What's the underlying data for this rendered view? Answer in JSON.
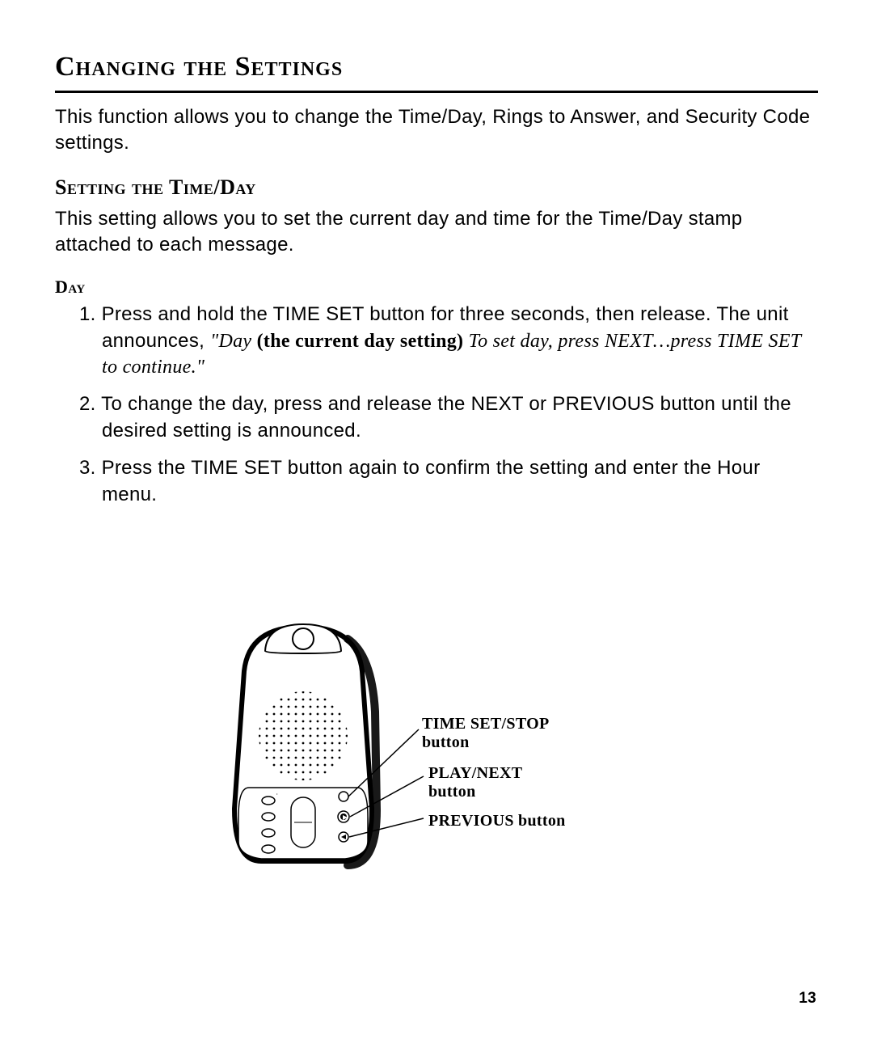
{
  "title": "Changing the Settings",
  "intro": "This function allows you to change the Time/Day, Rings to Answer, and Security Code settings.",
  "section": {
    "heading": "Setting the Time/Day",
    "text": "This setting allows you to set the current day and time for the Time/Day stamp attached to each message."
  },
  "day": {
    "heading": "Day",
    "steps": {
      "s1_lead": "1. Press and hold the TIME SET button for three seconds, then release. The unit announces, ",
      "s1_q1": "\"Day ",
      "s1_bold": "(the current day setting)",
      "s1_q2": " To set day, press NEXT…press TIME SET to continue.\"",
      "s2": "2. To change the day, press and release the NEXT or PREVIOUS button until the desired setting is announced.",
      "s3": "3. Press the TIME SET button again to confirm the setting and enter the Hour menu."
    }
  },
  "figure": {
    "callouts": {
      "time_set_l1": "TIME SET/STOP",
      "time_set_l2": "button",
      "play_next_l1": "PLAY/NEXT",
      "play_next_l2": "button",
      "previous": "PREVIOUS  button"
    }
  },
  "page_number": "13"
}
